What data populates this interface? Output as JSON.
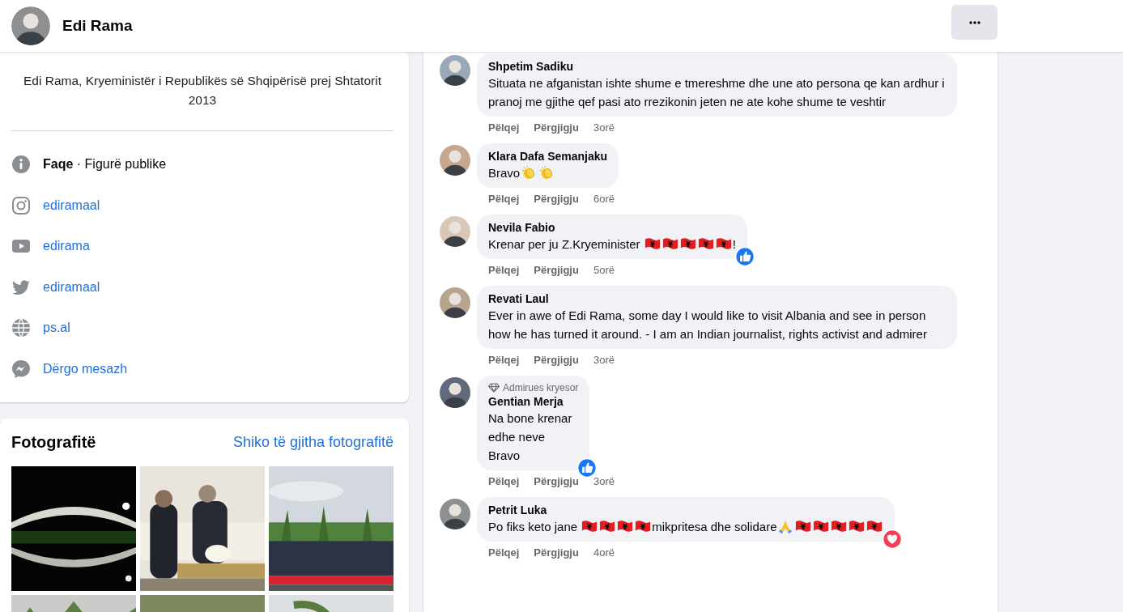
{
  "header": {
    "name": "Edi Rama"
  },
  "intro": {
    "description": "Edi Rama, Kryeministër i Republikës së Shqipërisë prej Shtatorit 2013",
    "rows": [
      {
        "kind": "info",
        "text": "**Faqe** · Figurë publike"
      },
      {
        "kind": "instagram",
        "text": "ediramaal"
      },
      {
        "kind": "youtube",
        "text": "edirama"
      },
      {
        "kind": "twitter",
        "text": "ediramaal"
      },
      {
        "kind": "web",
        "text": "ps.al"
      },
      {
        "kind": "messenger",
        "text": "Dërgo mesazh"
      }
    ]
  },
  "photos": {
    "title": "Fotografitë",
    "link": "Shiko të gjitha fotografitë"
  },
  "comments": [
    {
      "author": "Shpetim Sadiku",
      "parts": [
        {
          "kind": "text",
          "text": "Situata ne afganistan ishte shume e tmereshme dhe une ato persona qe kan ardhur i pranoj me gjithe qef pasi ato rrezikonin jeten ne ate kohe shume te veshtir"
        }
      ],
      "like": "Pëlqej",
      "reply": "Përgjigju",
      "time": "3orë"
    },
    {
      "author": "Klara Dafa Semanjaku",
      "parts": [
        {
          "kind": "text",
          "text": "Bravo"
        },
        {
          "kind": "clap"
        },
        {
          "kind": "clap"
        }
      ],
      "like": "Pëlqej",
      "reply": "Përgjigju",
      "time": "6orë"
    },
    {
      "author": "Nevila Fabio",
      "parts": [
        {
          "kind": "text",
          "text": "Krenar per ju Z.Kryeminister "
        },
        {
          "kind": "flag"
        },
        {
          "kind": "flag"
        },
        {
          "kind": "flag"
        },
        {
          "kind": "flag"
        },
        {
          "kind": "flag"
        },
        {
          "kind": "text",
          "text": "!"
        }
      ],
      "reaction": {
        "kind": "like"
      },
      "like": "Pëlqej",
      "reply": "Përgjigju",
      "time": "5orë"
    },
    {
      "author": "Revati Laul",
      "parts": [
        {
          "kind": "text",
          "text": "Ever in awe of Edi Rama, some day I would like to visit Albania and see in person how he has turned it around. - I am an Indian journalist, rights activist and admirer"
        }
      ],
      "like": "Pëlqej",
      "reply": "Përgjigju",
      "time": "3orë"
    },
    {
      "author": "Gentian Merja",
      "badge": "Admirues kryesor",
      "parts": [
        {
          "kind": "text",
          "text": "Na bone krenar\nedhe neve\nBravo"
        }
      ],
      "reaction": {
        "kind": "like"
      },
      "like": "Pëlqej",
      "reply": "Përgjigju",
      "time": "3orë"
    },
    {
      "author": "Petrit Luka",
      "parts": [
        {
          "kind": "text",
          "text": "Po fiks keto jane "
        },
        {
          "kind": "flag"
        },
        {
          "kind": "flag"
        },
        {
          "kind": "flag"
        },
        {
          "kind": "flag"
        },
        {
          "kind": "text",
          "text": "mikpritesa dhe solidare"
        },
        {
          "kind": "pray"
        },
        {
          "kind": "flag"
        },
        {
          "kind": "flag"
        },
        {
          "kind": "flag"
        },
        {
          "kind": "flag"
        },
        {
          "kind": "flag"
        }
      ],
      "reaction": {
        "kind": "love"
      },
      "like": "Pëlqej",
      "reply": "Përgjigju",
      "time": "4orë"
    }
  ]
}
